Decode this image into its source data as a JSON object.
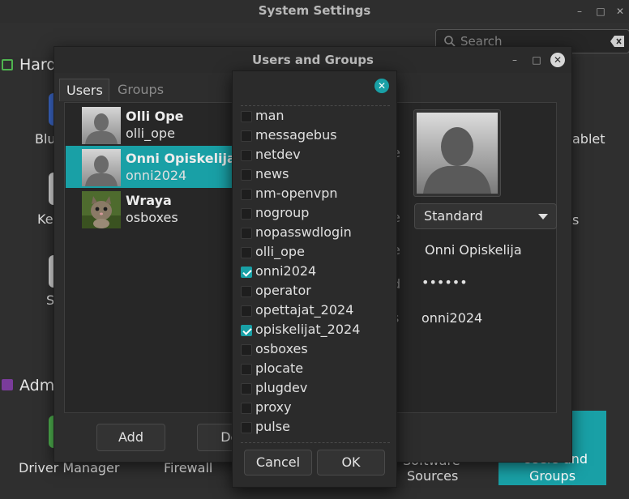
{
  "system_settings": {
    "title": "System Settings",
    "search": {
      "placeholder": "Search"
    },
    "categories": {
      "hardware": "Hard",
      "administration": "Adm"
    },
    "partial_items": {
      "blu": "Blu",
      "ke": "Ke",
      "s": "S",
      "tablet": "ablet",
      "s2": "s"
    },
    "items": {
      "driver_manager": "Driver Manager",
      "firewall": "Firewall",
      "software_sources_line1": "Software",
      "software_sources_line2": "Sources",
      "users_groups_line1": "Users and",
      "users_groups_line2": "Groups"
    }
  },
  "users_and_groups": {
    "title": "Users and Groups",
    "tabs": {
      "users": "Users",
      "groups": "Groups"
    },
    "users": [
      {
        "name": "Olli Ope",
        "login": "olli_ope",
        "selected": false
      },
      {
        "name": "Onni Opiskelija",
        "login": "onni2024",
        "selected": true
      },
      {
        "name": "Wraya",
        "login": "osboxes",
        "selected": false
      }
    ],
    "buttons": {
      "add": "Add",
      "delete": "Del"
    },
    "details": {
      "label_fragments": [
        "e",
        "e",
        "e",
        "d",
        "s"
      ],
      "account_type": "Standard",
      "name": "Onni Opiskelija",
      "password": "••••••",
      "groups": "onni2024"
    }
  },
  "group_picker": {
    "groups": [
      {
        "name": "man",
        "checked": false
      },
      {
        "name": "messagebus",
        "checked": false
      },
      {
        "name": "netdev",
        "checked": false
      },
      {
        "name": "news",
        "checked": false
      },
      {
        "name": "nm-openvpn",
        "checked": false
      },
      {
        "name": "nogroup",
        "checked": false
      },
      {
        "name": "nopasswdlogin",
        "checked": false
      },
      {
        "name": "olli_ope",
        "checked": false
      },
      {
        "name": "onni2024",
        "checked": true
      },
      {
        "name": "operator",
        "checked": false
      },
      {
        "name": "opettajat_2024",
        "checked": false
      },
      {
        "name": "opiskelijat_2024",
        "checked": true
      },
      {
        "name": "osboxes",
        "checked": false
      },
      {
        "name": "plocate",
        "checked": false
      },
      {
        "name": "plugdev",
        "checked": false
      },
      {
        "name": "proxy",
        "checked": false
      },
      {
        "name": "pulse",
        "checked": false
      }
    ],
    "buttons": {
      "cancel": "Cancel",
      "ok": "OK"
    }
  },
  "colors": {
    "accent": "#19a0a6",
    "background": "#2f2f2f"
  }
}
